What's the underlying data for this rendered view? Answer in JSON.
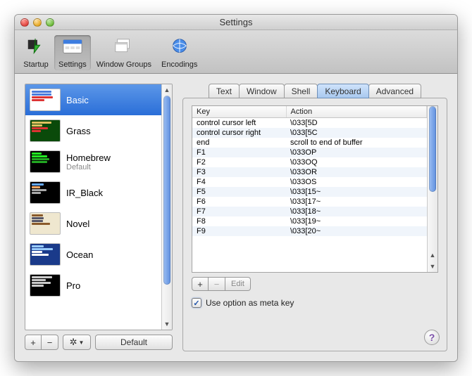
{
  "window": {
    "title": "Settings"
  },
  "toolbar": {
    "items": [
      {
        "label": "Startup"
      },
      {
        "label": "Settings"
      },
      {
        "label": "Window Groups"
      },
      {
        "label": "Encodings"
      }
    ]
  },
  "sidebar": {
    "profiles": [
      {
        "name": "Basic",
        "selected": true
      },
      {
        "name": "Grass"
      },
      {
        "name": "Homebrew",
        "sub": "Default"
      },
      {
        "name": "IR_Black"
      },
      {
        "name": "Novel"
      },
      {
        "name": "Ocean"
      },
      {
        "name": "Pro"
      }
    ],
    "buttons": {
      "add": "+",
      "remove": "−",
      "default": "Default"
    }
  },
  "tabs": {
    "items": [
      {
        "label": "Text"
      },
      {
        "label": "Window"
      },
      {
        "label": "Shell"
      },
      {
        "label": "Keyboard",
        "active": true
      },
      {
        "label": "Advanced"
      }
    ]
  },
  "table": {
    "columns": {
      "key": "Key",
      "action": "Action"
    },
    "rows": [
      {
        "key": "control cursor left",
        "action": "\\033[5D"
      },
      {
        "key": "control cursor right",
        "action": "\\033[5C"
      },
      {
        "key": "end",
        "action": "scroll to end of buffer"
      },
      {
        "key": "F1",
        "action": "\\033OP"
      },
      {
        "key": "F2",
        "action": "\\033OQ"
      },
      {
        "key": "F3",
        "action": "\\033OR"
      },
      {
        "key": "F4",
        "action": "\\033OS"
      },
      {
        "key": "F5",
        "action": "\\033[15~"
      },
      {
        "key": "F6",
        "action": "\\033[17~"
      },
      {
        "key": "F7",
        "action": "\\033[18~"
      },
      {
        "key": "F8",
        "action": "\\033[19~"
      },
      {
        "key": "F9",
        "action": "\\033[20~"
      }
    ],
    "buttons": {
      "add": "+",
      "remove": "−",
      "edit": "Edit"
    }
  },
  "option_meta": {
    "label": "Use option as meta key",
    "checked": true
  },
  "help": "?"
}
